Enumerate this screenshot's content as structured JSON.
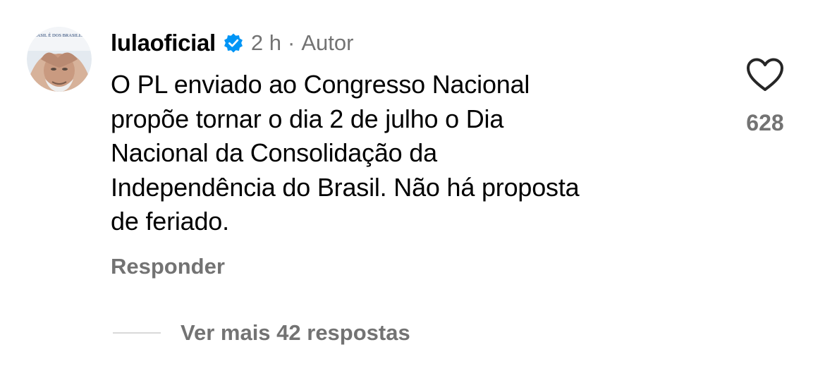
{
  "comment": {
    "username": "lulaoficial",
    "time_ago": "2 h",
    "separator": "·",
    "author_tag": "Autor",
    "text": "O PL enviado ao Congresso Nacional\npropõe tornar o dia 2 de julho o Dia\nNacional da Consolidação da\nIndependência do Brasil. Não há proposta\nde feriado.",
    "reply_label": "Responder",
    "like_count": "628",
    "view_replies_label": "Ver mais 42 respostas",
    "avatar_caption": "O BRASIL É DOS BRASILEIROS"
  },
  "icons": {
    "verified": "verified-badge-icon",
    "like": "heart-outline-icon"
  },
  "colors": {
    "verified_blue": "#0095f6",
    "secondary_text": "#737373",
    "primary_text": "#000000",
    "divider": "#d9d9d9"
  }
}
